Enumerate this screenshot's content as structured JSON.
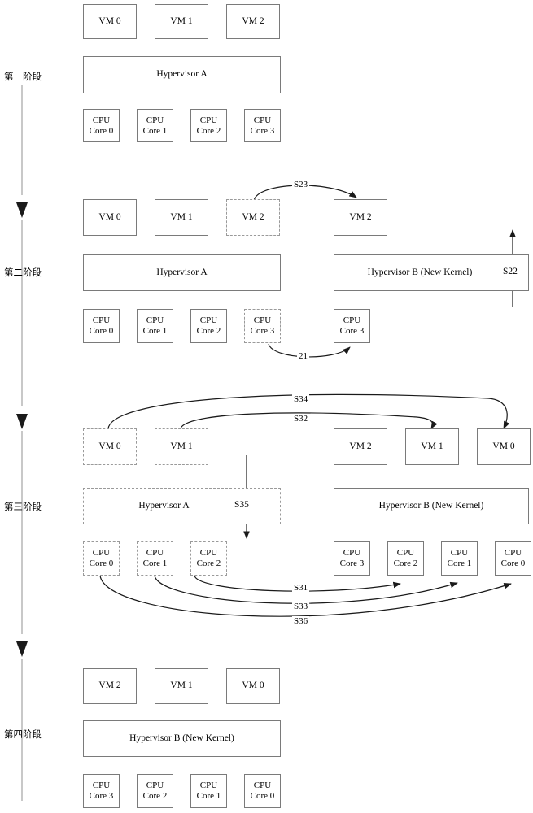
{
  "diagram": {
    "title": "Hypervisor live upgrade staged migration diagram",
    "colors": {
      "box_border_solid": "#7a7a7a",
      "box_border_dashed": "#9a9a9a",
      "line": "#1a1a1a",
      "background": "#ffffff"
    },
    "stages": [
      {
        "id": "stage-1",
        "label": "第一阶段",
        "vms": [
          {
            "label": "VM 0",
            "style": "solid"
          },
          {
            "label": "VM 1",
            "style": "solid"
          },
          {
            "label": "VM 2",
            "style": "solid"
          }
        ],
        "hypervisors": [
          {
            "label": "Hypervisor A",
            "style": "solid"
          }
        ],
        "cpus": [
          {
            "line1": "CPU",
            "line2": "Core 0",
            "style": "solid"
          },
          {
            "line1": "CPU",
            "line2": "Core 1",
            "style": "solid"
          },
          {
            "line1": "CPU",
            "line2": "Core 2",
            "style": "solid"
          },
          {
            "line1": "CPU",
            "line2": "Core 3",
            "style": "solid"
          }
        ],
        "edges": []
      },
      {
        "id": "stage-2",
        "label": "第二阶段",
        "vms": [
          {
            "label": "VM 0",
            "style": "solid"
          },
          {
            "label": "VM 1",
            "style": "solid"
          },
          {
            "label": "VM 2",
            "style": "dashed"
          },
          {
            "label": "VM 2",
            "style": "solid"
          }
        ],
        "hypervisors": [
          {
            "label": "Hypervisor A",
            "style": "solid"
          },
          {
            "label": "Hypervisor B (New Kernel)",
            "style": "solid"
          }
        ],
        "cpus": [
          {
            "line1": "CPU",
            "line2": "Core 0",
            "style": "solid"
          },
          {
            "line1": "CPU",
            "line2": "Core 1",
            "style": "solid"
          },
          {
            "line1": "CPU",
            "line2": "Core 2",
            "style": "solid"
          },
          {
            "line1": "CPU",
            "line2": "Core 3",
            "style": "dashed"
          },
          {
            "line1": "CPU",
            "line2": "Core 3",
            "style": "solid"
          }
        ],
        "edges": [
          {
            "label": "S23",
            "from": "VM 2 (Hypervisor A)",
            "to": "VM 2 (Hypervisor B)"
          },
          {
            "label": "S22",
            "from": "below Hypervisor B",
            "to": "Hypervisor B boot"
          },
          {
            "label": "21",
            "from": "CPU Core 3 (Hypervisor A)",
            "to": "CPU Core 3 (Hypervisor B)"
          }
        ]
      },
      {
        "id": "stage-3",
        "label": "第三阶段",
        "vms": [
          {
            "label": "VM 0",
            "style": "dashed"
          },
          {
            "label": "VM 1",
            "style": "dashed"
          },
          {
            "label": "VM 2",
            "style": "solid"
          },
          {
            "label": "VM 1",
            "style": "solid"
          },
          {
            "label": "VM 0",
            "style": "solid"
          }
        ],
        "hypervisors": [
          {
            "label": "Hypervisor A",
            "style": "dashed"
          },
          {
            "label": "Hypervisor B (New Kernel)",
            "style": "solid"
          }
        ],
        "cpus": [
          {
            "line1": "CPU",
            "line2": "Core 0",
            "style": "dashed"
          },
          {
            "line1": "CPU",
            "line2": "Core 1",
            "style": "dashed"
          },
          {
            "line1": "CPU",
            "line2": "Core 2",
            "style": "dashed"
          },
          {
            "line1": "CPU",
            "line2": "Core 3",
            "style": "solid"
          },
          {
            "line1": "CPU",
            "line2": "Core 2",
            "style": "solid"
          },
          {
            "line1": "CPU",
            "line2": "Core 1",
            "style": "solid"
          },
          {
            "line1": "CPU",
            "line2": "Core 0",
            "style": "solid"
          }
        ],
        "edges": [
          {
            "label": "S34",
            "from": "VM 0 (Hypervisor A)",
            "to": "VM 0 (Hypervisor B)"
          },
          {
            "label": "S32",
            "from": "VM 1 (Hypervisor A)",
            "to": "VM 1 (Hypervisor B)"
          },
          {
            "label": "S35",
            "from": "Hypervisor A",
            "to": "CPU Core 2 release"
          },
          {
            "label": "S31",
            "from": "CPU Core 2 (Hypervisor A)",
            "to": "CPU Core 2 (Hypervisor B)"
          },
          {
            "label": "S33",
            "from": "CPU Core 1 (Hypervisor A)",
            "to": "CPU Core 1 (Hypervisor B)"
          },
          {
            "label": "S36",
            "from": "CPU Core 0 (Hypervisor A)",
            "to": "CPU Core 0 (Hypervisor B)"
          }
        ]
      },
      {
        "id": "stage-4",
        "label": "第四阶段",
        "vms": [
          {
            "label": "VM 2",
            "style": "solid"
          },
          {
            "label": "VM 1",
            "style": "solid"
          },
          {
            "label": "VM 0",
            "style": "solid"
          }
        ],
        "hypervisors": [
          {
            "label": "Hypervisor B (New Kernel)",
            "style": "solid"
          }
        ],
        "cpus": [
          {
            "line1": "CPU",
            "line2": "Core 3",
            "style": "solid"
          },
          {
            "line1": "CPU",
            "line2": "Core 2",
            "style": "solid"
          },
          {
            "line1": "CPU",
            "line2": "Core 1",
            "style": "solid"
          },
          {
            "line1": "CPU",
            "line2": "Core 0",
            "style": "solid"
          }
        ],
        "edges": []
      }
    ]
  }
}
